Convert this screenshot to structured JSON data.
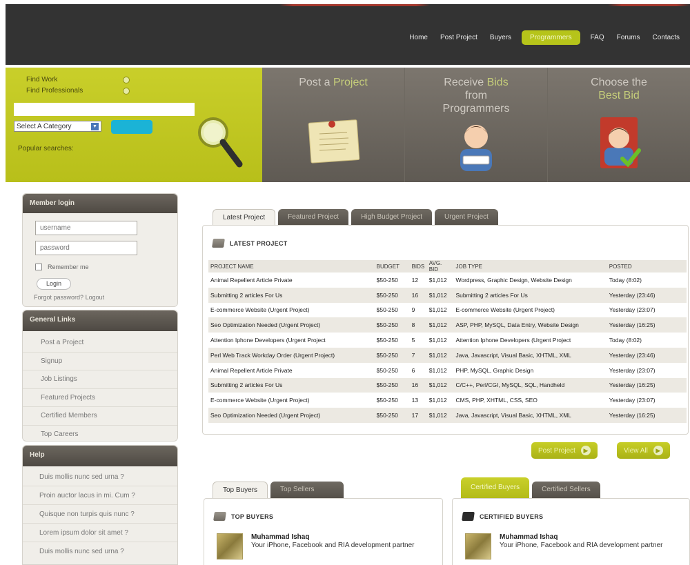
{
  "nav": {
    "items": [
      {
        "label": "Home",
        "active": false
      },
      {
        "label": "Post Project",
        "active": false
      },
      {
        "label": "Buyers",
        "active": false
      },
      {
        "label": "Programmers",
        "active": true
      },
      {
        "label": "FAQ",
        "active": false
      },
      {
        "label": "Forums",
        "active": false
      },
      {
        "label": "Contacts",
        "active": false
      }
    ]
  },
  "search": {
    "find_work": "Find Work",
    "find_professionals": "Find Professionals",
    "input_value": "",
    "category": "Select A Category",
    "popular": "Popular searches:"
  },
  "steps": {
    "post_a": "Post a",
    "project": "Project",
    "receive": "Receive",
    "bids": "Bids",
    "from": "from",
    "programmers": "Programmers",
    "choose_the": "Choose the",
    "best_bid": "Best Bid"
  },
  "login": {
    "title": "Member login",
    "username_placeholder": "username",
    "password_placeholder": "password",
    "remember": "Remember me",
    "login_button": "Login",
    "forgot": "Forgot password?",
    "logout": "Logout"
  },
  "general_links": {
    "title": "General Links",
    "items": [
      "Post a Project",
      "Signup",
      "Job Listings",
      "Featured Projects",
      "Certified Members",
      "Top Careers"
    ]
  },
  "help": {
    "title": "Help",
    "items": [
      "Duis mollis nunc sed urna ?",
      "Proin auctor lacus in mi. Cum ?",
      "Quisque non turpis quis nunc ?",
      "Lorem ipsum dolor sit amet ?",
      "Duis mollis nunc sed urna ?"
    ]
  },
  "project_tabs": [
    "Latest Project",
    "Featured Project",
    "High Budget Project",
    "Urgent Project"
  ],
  "projects": {
    "title": "LATEST PROJECT",
    "columns": [
      "PROJECT NAME",
      "BUDGET",
      "BIDS",
      "AVG. BID",
      "JOB TYPE",
      "POSTED"
    ],
    "rows": [
      [
        "Animal Repellent Article Private",
        "$50-250",
        "12",
        "$1,012",
        "Wordpress, Graphic Design, Website Design",
        "Today (8:02)"
      ],
      [
        "Submitting 2 articles For Us",
        "$50-250",
        "16",
        "$1,012",
        "Submitting 2 articles For Us",
        "Yesterday (23:46)"
      ],
      [
        "E-commerce Website (Urgent Project)",
        "$50-250",
        "9",
        "$1,012",
        "E-commerce Website (Urgent Project)",
        "Yesterday (23:07)"
      ],
      [
        "Seo Optimization Needed (Urgent Project)",
        "$50-250",
        "8",
        "$1,012",
        "ASP, PHP, MySQL, Data Entry, Website Design",
        "Yesterday (16:25)"
      ],
      [
        "Attention Iphone Developers (Urgent Project",
        "$50-250",
        "5",
        "$1,012",
        "Attention Iphone Developers (Urgent Project",
        "Today (8:02)"
      ],
      [
        "Perl Web Track Workday Order (Urgent Project)",
        "$50-250",
        "7",
        "$1,012",
        "Java, Javascript, Visual Basic, XHTML, XML",
        "Yesterday (23:46)"
      ],
      [
        "Animal Repellent Article Private",
        "$50-250",
        "6",
        "$1,012",
        "PHP, MySQL, Graphic Design",
        "Yesterday (23:07)"
      ],
      [
        "Submitting 2 articles For Us",
        "$50-250",
        "16",
        "$1,012",
        "C/C++, Perl/CGI, MySQL, SQL, Handheld",
        "Yesterday (16:25)"
      ],
      [
        "E-commerce Website (Urgent Project)",
        "$50-250",
        "13",
        "$1,012",
        "CMS, PHP, XHTML, CSS, SEO",
        "Yesterday (23:07)"
      ],
      [
        "Seo Optimization Needed (Urgent Project)",
        "$50-250",
        "17",
        "$1,012",
        "Java, Javascript, Visual Basic, XHTML, XML",
        "Yesterday (16:25)"
      ]
    ]
  },
  "actions": {
    "post_project": "Post Project",
    "view_all": "View All"
  },
  "buyers_tabs": [
    "Top Buyers",
    "Top Sellers"
  ],
  "top_buyers": {
    "title": "TOP BUYERS",
    "name": "Muhammad Ishaq",
    "desc": "Your iPhone, Facebook and RIA development partner"
  },
  "certified_tabs": [
    "Certified Buyers",
    "Certified Sellers"
  ],
  "certified_buyers": {
    "title": "CERTIFIED BUYERS",
    "name": "Muhammad Ishaq",
    "desc": "Your iPhone, Facebook and RIA development partner"
  },
  "colors": {
    "accent_green": "#b8bf1a",
    "header_dark": "#333333",
    "panel_brown": "#5f5a53",
    "search_button": "#1bb3d6"
  }
}
